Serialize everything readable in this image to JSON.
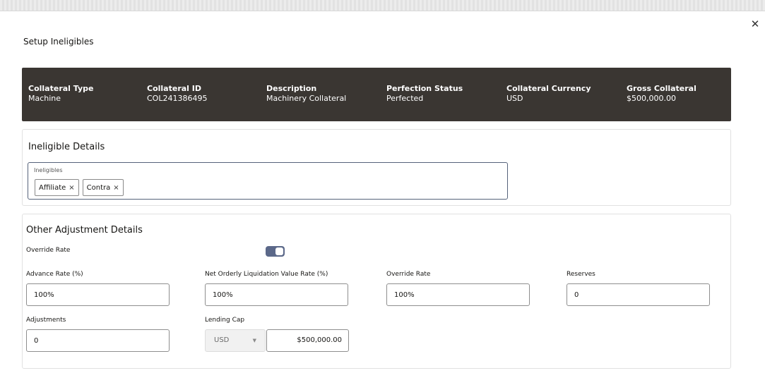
{
  "dialog": {
    "title": "Setup Ineligibles",
    "close_icon": "close-icon"
  },
  "summary": {
    "columns": [
      {
        "label": "Collateral Type",
        "value": "Machine"
      },
      {
        "label": "Collateral ID",
        "value": "COL241386495"
      },
      {
        "label": "Description",
        "value": "Machinery Collateral"
      },
      {
        "label": "Perfection Status",
        "value": "Perfected"
      },
      {
        "label": "Collateral Currency",
        "value": "USD"
      },
      {
        "label": "Gross Collateral",
        "value": "$500,000.00"
      }
    ]
  },
  "ineligible": {
    "title": "Ineligible Details",
    "field_label": "Ineligibles",
    "tags": [
      {
        "label": "Affiliate",
        "remove": "×"
      },
      {
        "label": "Contra",
        "remove": "×"
      }
    ]
  },
  "adjustments": {
    "title": "Other Adjustment Details",
    "override_rate_toggle": {
      "label": "Override Rate",
      "checked": true
    },
    "advance_rate": {
      "label": "Advance Rate (%)",
      "value": "100%"
    },
    "nolv_rate": {
      "label": "Net Orderly Liquidation Value Rate (%)",
      "value": "100%"
    },
    "override_rate": {
      "label": "Override Rate",
      "value": "100%"
    },
    "reserves": {
      "label": "Reserves",
      "value": "0"
    },
    "adjustments": {
      "label": "Adjustments",
      "value": "0"
    },
    "lending_cap": {
      "label": "Lending Cap",
      "currency": "USD",
      "amount": "$500,000.00"
    }
  },
  "colors": {
    "summary_bg": "#3a3632",
    "toggle_on": "#5b6889",
    "focus_border": "#55627a"
  }
}
